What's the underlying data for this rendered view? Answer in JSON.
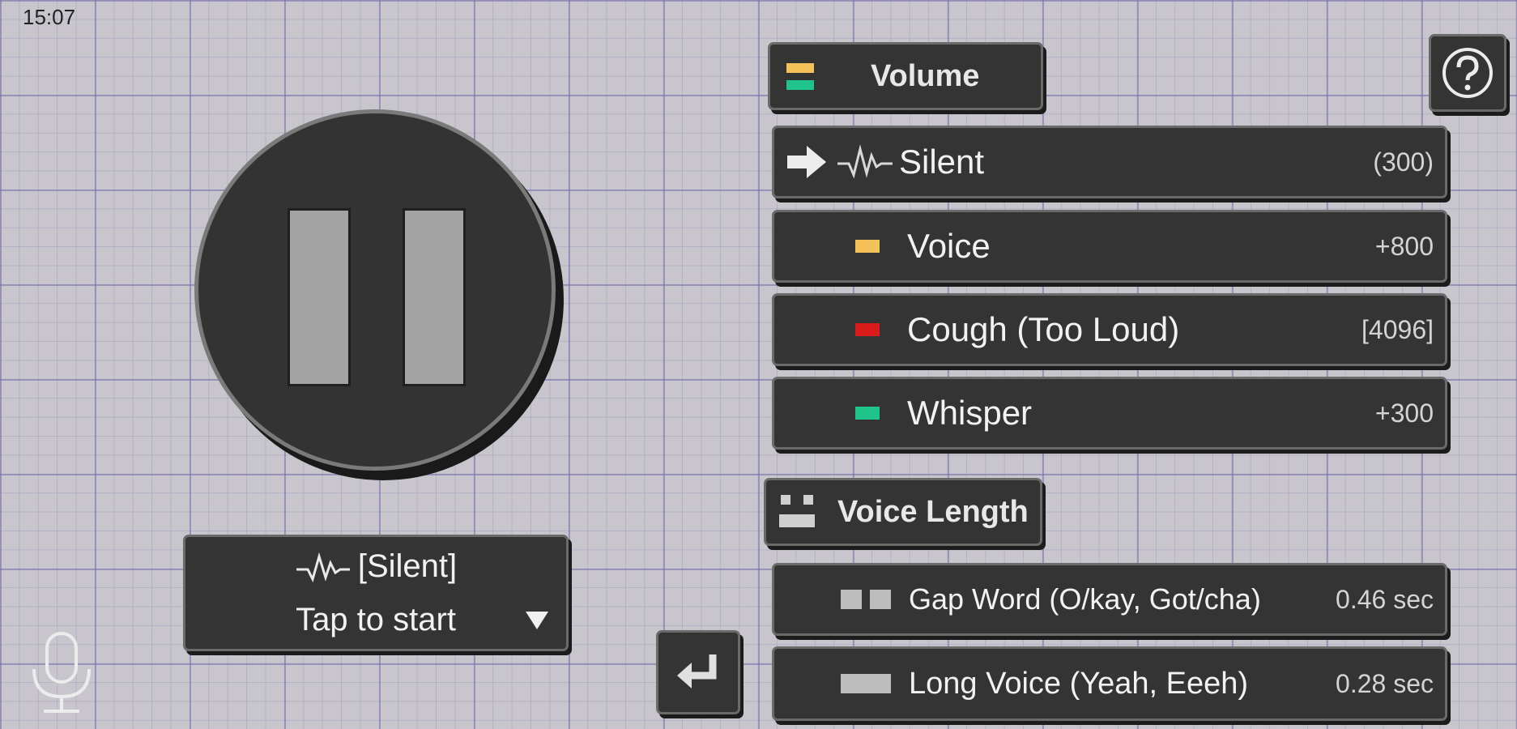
{
  "status_bar": {
    "time": "15:07"
  },
  "status_panel": {
    "state": "[Silent]",
    "hint": "Tap to start"
  },
  "volume": {
    "header": "Volume",
    "rows": [
      {
        "label": "Silent",
        "value": "(300)",
        "icon": "arrow-right-icon"
      },
      {
        "label": "Voice",
        "value": "+800",
        "color": "#f3c35a"
      },
      {
        "label": "Cough (Too Loud)",
        "value": "[4096]",
        "color": "#d81b1b"
      },
      {
        "label": "Whisper",
        "value": "+300",
        "color": "#1ec48a"
      }
    ]
  },
  "voice_length": {
    "header": "Voice Length",
    "rows": [
      {
        "label": "Gap Word (O/kay, Got/cha)",
        "value": "0.46 sec"
      },
      {
        "label": "Long Voice (Yeah, Eeeh)",
        "value": "0.28 sec"
      }
    ]
  },
  "icons": {
    "help": "help-icon",
    "microphone": "microphone-icon",
    "enter": "enter-icon",
    "waveform": "waveform-icon",
    "pause": "pause-icon"
  }
}
